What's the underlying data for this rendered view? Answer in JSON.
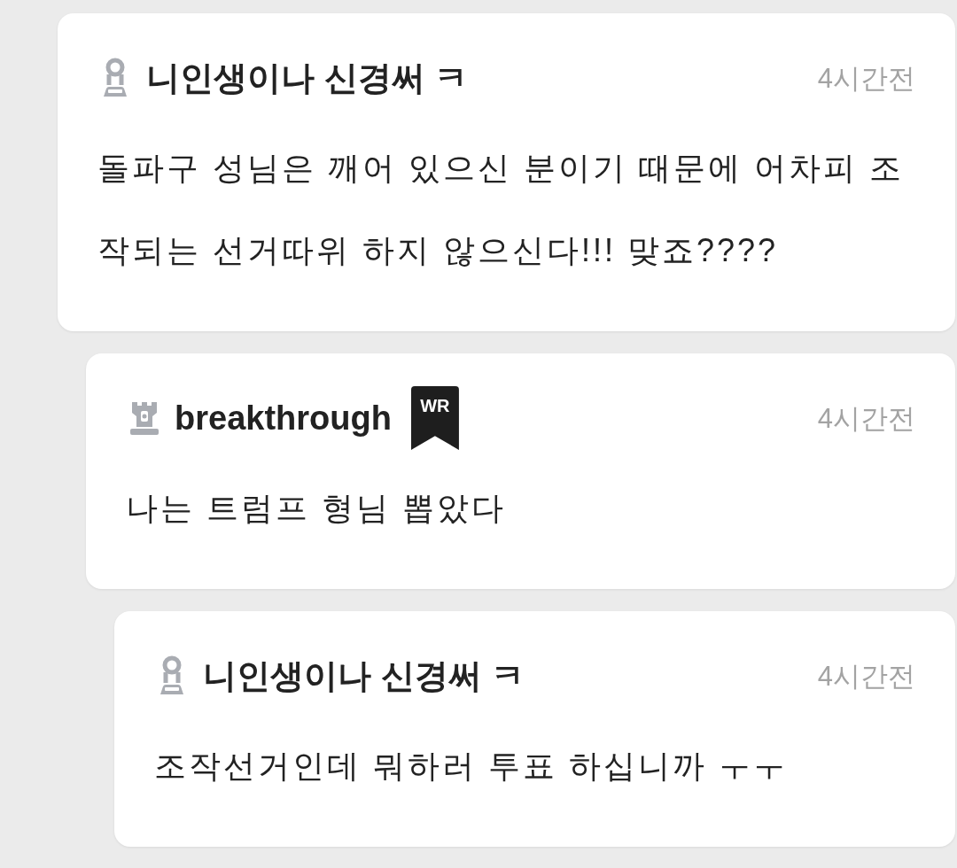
{
  "comments": [
    {
      "author": "니인생이나 신경써 ㅋ",
      "kind": "pawn",
      "time": "4시간전",
      "text": "돌파구 성님은 깨어 있으신 분이기 때문에 어차피 조작되는 선거따위 하지 않으신다!!! 맞죠????",
      "children": [
        {
          "author": "breakthrough",
          "kind": "rook",
          "badge": "WR",
          "time": "4시간전",
          "text": "나는 트럼프 형님 뽑았다",
          "children": [
            {
              "author": "니인생이나 신경써 ㅋ",
              "kind": "pawn",
              "time": "4시간전",
              "text": "조작선거인데 뭐하러 투표 하십니까 ㅜㅜ"
            }
          ]
        }
      ]
    }
  ]
}
